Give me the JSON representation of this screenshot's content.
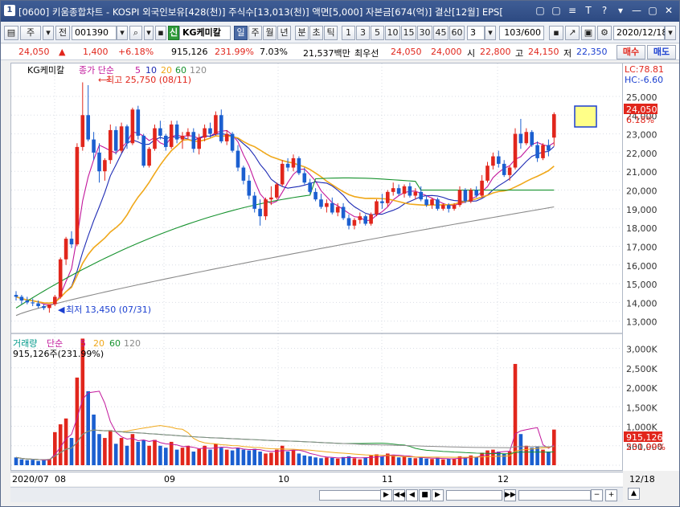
{
  "window": {
    "badge": "1",
    "title": "[0600] 키움종합차트 - KOSPI 외국인보유[428(천)] 주식수[13,013(천)] 액면[5,000] 자본금[674(억)] 결산[12월] EPS[",
    "controls": [
      "▢",
      "▢",
      "≡",
      "T",
      "?",
      "▾",
      "—",
      "▢",
      "✕"
    ]
  },
  "toolbar": {
    "period_label": "주",
    "prev_label": "전",
    "code_value": "001390",
    "stock_name": "KG케미칼",
    "intervals": [
      "일",
      "주",
      "월",
      "년",
      "분",
      "초",
      "틱"
    ],
    "selected_interval": "일",
    "minute_options": [
      "1",
      "3",
      "5",
      "10",
      "15",
      "30",
      "45",
      "60"
    ],
    "count_value": "3",
    "page_display": "103/600",
    "date_value": "2020/12/18"
  },
  "quote": {
    "price": "24,050",
    "change": "1,400",
    "change_pct": "+6.18%",
    "volume": "915,126",
    "volume_pct": "231.99%",
    "turnover_pct": "7.03%",
    "trade_value": "21,537백만",
    "best_bid_label": "최우선",
    "best_bid": "24,050",
    "best_ask": "24,000",
    "open_label": "시",
    "open": "22,800",
    "high_label": "고",
    "high": "24,150",
    "low_label": "저",
    "low": "22,350",
    "buy_button": "매수",
    "sell_button": "매도"
  },
  "price_pane": {
    "stock_tag": "KG케미칼",
    "legend_prefix": "종가 단순",
    "ma_periods": [
      "5",
      "10",
      "20",
      "60",
      "120"
    ],
    "ma_colors": [
      "#c2189c",
      "#1d2ab4",
      "#f0a81a",
      "#16922e",
      "#8a8a8a"
    ],
    "max_annotation": "최고 25,750 (08/11)",
    "min_annotation": "최저 13,450 (07/31)",
    "lc_label": "LC:78.81",
    "hc_label": "HC:-6.60",
    "price_tag": "24,050",
    "pct_tag": "6.18%",
    "y_ticks": [
      "25,000",
      "24,000",
      "23,000",
      "22,000",
      "21,000",
      "20,000",
      "19,000",
      "18,000",
      "17,000",
      "16,000",
      "15,000",
      "14,000",
      "13,000"
    ]
  },
  "volume_pane": {
    "title": "거래량",
    "legend_prefix": "단순",
    "ma_periods": [
      "5",
      "20",
      "60",
      "120"
    ],
    "current_label": "915,126주(231.99%)",
    "y_ticks": [
      "3,000K",
      "2,500K",
      "2,000K",
      "1,500K",
      "1,000K",
      "500,000"
    ],
    "vol_tag": "915,126",
    "vol_pct_tag": "231.99%"
  },
  "x_axis": {
    "labels": [
      "2020/07",
      "08",
      "09",
      "10",
      "11",
      "12"
    ],
    "end_label": "12/18"
  },
  "scroll": {
    "buttons": [
      "▶",
      "◀◀",
      "◀",
      "■",
      "▶",
      "▶▶",
      "−",
      "+",
      "▲"
    ]
  },
  "chart_data": {
    "type": "candlestick",
    "ohlc": [
      [
        14400,
        14600,
        14100,
        14300
      ],
      [
        14300,
        14400,
        13900,
        14100
      ],
      [
        14100,
        14300,
        13900,
        14000
      ],
      [
        14000,
        14200,
        13800,
        13950
      ],
      [
        13950,
        14100,
        13700,
        13800
      ],
      [
        13800,
        13900,
        13600,
        13700
      ],
      [
        13700,
        13800,
        13450,
        13900
      ],
      [
        13900,
        14400,
        13800,
        14300
      ],
      [
        14300,
        16400,
        14200,
        16300
      ],
      [
        16300,
        17500,
        16000,
        17400
      ],
      [
        17400,
        17800,
        16900,
        17100
      ],
      [
        17100,
        22500,
        17000,
        22300
      ],
      [
        22300,
        25750,
        22100,
        24000
      ],
      [
        24000,
        25600,
        22600,
        22700
      ],
      [
        22700,
        23100,
        21600,
        22000
      ],
      [
        22000,
        22500,
        20400,
        21000
      ],
      [
        21000,
        21700,
        20500,
        21600
      ],
      [
        21600,
        23500,
        21400,
        23200
      ],
      [
        23200,
        23400,
        21900,
        22100
      ],
      [
        22100,
        23600,
        22000,
        23400
      ],
      [
        23400,
        23500,
        22200,
        22500
      ],
      [
        22500,
        24400,
        22400,
        24300
      ],
      [
        24300,
        24500,
        22700,
        22900
      ],
      [
        22900,
        23000,
        21200,
        21300
      ],
      [
        21300,
        22300,
        21200,
        22200
      ],
      [
        22200,
        23500,
        22100,
        23300
      ],
      [
        23300,
        23700,
        22700,
        22900
      ],
      [
        22900,
        23000,
        22100,
        22300
      ],
      [
        22300,
        23700,
        22200,
        23500
      ],
      [
        23500,
        23700,
        22500,
        22700
      ],
      [
        22700,
        23100,
        22200,
        22900
      ],
      [
        22900,
        23300,
        22700,
        23100
      ],
      [
        23100,
        23300,
        22000,
        22200
      ],
      [
        22200,
        23000,
        21900,
        22800
      ],
      [
        22800,
        23500,
        22600,
        23300
      ],
      [
        23300,
        23600,
        22800,
        23000
      ],
      [
        23000,
        24200,
        22900,
        24000
      ],
      [
        24000,
        24300,
        22500,
        22600
      ],
      [
        22600,
        23200,
        22400,
        23000
      ],
      [
        23000,
        23100,
        22000,
        22100
      ],
      [
        22100,
        22400,
        21000,
        21200
      ],
      [
        21200,
        21300,
        20300,
        20500
      ],
      [
        20500,
        20800,
        19500,
        19700
      ],
      [
        19700,
        19900,
        18800,
        19000
      ],
      [
        19000,
        19500,
        18100,
        18600
      ],
      [
        18600,
        19600,
        18400,
        19500
      ],
      [
        19500,
        20200,
        19200,
        19600
      ],
      [
        19600,
        20400,
        19500,
        20300
      ],
      [
        20300,
        21600,
        20200,
        21400
      ],
      [
        21400,
        21700,
        21000,
        21200
      ],
      [
        21200,
        21900,
        21000,
        21700
      ],
      [
        21700,
        21800,
        20800,
        20900
      ],
      [
        20900,
        21200,
        20300,
        20400
      ],
      [
        20400,
        20600,
        19800,
        19900
      ],
      [
        19900,
        20100,
        19400,
        19500
      ],
      [
        19500,
        19800,
        19000,
        19100
      ],
      [
        19100,
        19500,
        18800,
        19300
      ],
      [
        19300,
        19600,
        18700,
        18800
      ],
      [
        18800,
        19300,
        18600,
        19100
      ],
      [
        19100,
        19300,
        18400,
        18500
      ],
      [
        18500,
        18700,
        17900,
        18100
      ],
      [
        18100,
        18500,
        17900,
        18400
      ],
      [
        18400,
        18800,
        18200,
        18600
      ],
      [
        18600,
        18700,
        18100,
        18200
      ],
      [
        18200,
        18800,
        18100,
        18700
      ],
      [
        18700,
        19500,
        18600,
        19400
      ],
      [
        19400,
        19800,
        19000,
        19300
      ],
      [
        19300,
        20000,
        19100,
        19900
      ],
      [
        19900,
        20400,
        19700,
        20100
      ],
      [
        20100,
        20300,
        19700,
        19800
      ],
      [
        19800,
        20300,
        19600,
        20200
      ],
      [
        20200,
        20400,
        19600,
        19700
      ],
      [
        19700,
        20100,
        19500,
        19900
      ],
      [
        19900,
        20200,
        19400,
        19500
      ],
      [
        19500,
        19700,
        19100,
        19200
      ],
      [
        19200,
        19600,
        19000,
        19500
      ],
      [
        19500,
        19600,
        18900,
        19000
      ],
      [
        19000,
        19300,
        18900,
        19200
      ],
      [
        19200,
        19300,
        18800,
        19000
      ],
      [
        19000,
        19300,
        18900,
        19200
      ],
      [
        19200,
        20200,
        19100,
        20000
      ],
      [
        20000,
        20100,
        19300,
        19400
      ],
      [
        19400,
        20100,
        19300,
        20000
      ],
      [
        20000,
        20200,
        19600,
        19700
      ],
      [
        19700,
        20800,
        19600,
        20500
      ],
      [
        20500,
        21500,
        20400,
        21300
      ],
      [
        21300,
        22000,
        21100,
        21800
      ],
      [
        21800,
        22100,
        21200,
        21400
      ],
      [
        21400,
        21600,
        20700,
        20800
      ],
      [
        20800,
        21300,
        20500,
        21200
      ],
      [
        21200,
        23300,
        21100,
        23000
      ],
      [
        23000,
        23800,
        22200,
        22500
      ],
      [
        22500,
        23300,
        22400,
        23100
      ],
      [
        23100,
        23200,
        22300,
        22400
      ],
      [
        22400,
        22600,
        21500,
        21700
      ],
      [
        21700,
        22500,
        21600,
        22400
      ],
      [
        22400,
        22700,
        21800,
        22100
      ],
      [
        22800,
        24150,
        22350,
        24050
      ]
    ],
    "volume_k": [
      200,
      150,
      130,
      140,
      110,
      130,
      160,
      850,
      1050,
      1200,
      700,
      2250,
      3250,
      1900,
      1300,
      800,
      700,
      900,
      550,
      700,
      500,
      800,
      600,
      650,
      500,
      650,
      500,
      450,
      600,
      400,
      450,
      500,
      350,
      420,
      500,
      400,
      550,
      450,
      400,
      380,
      450,
      400,
      380,
      420,
      350,
      300,
      320,
      400,
      500,
      350,
      380,
      300,
      250,
      230,
      200,
      180,
      200,
      190,
      170,
      210,
      230,
      180,
      150,
      200,
      250,
      280,
      230,
      300,
      260,
      200,
      220,
      190,
      180,
      200,
      170,
      160,
      190,
      150,
      170,
      160,
      230,
      200,
      250,
      210,
      320,
      380,
      400,
      350,
      300,
      360,
      2600,
      800,
      500,
      450,
      480,
      400,
      350,
      915
    ],
    "y_range": [
      12600,
      25900
    ],
    "volume_range_k": [
      0,
      3300
    ]
  }
}
